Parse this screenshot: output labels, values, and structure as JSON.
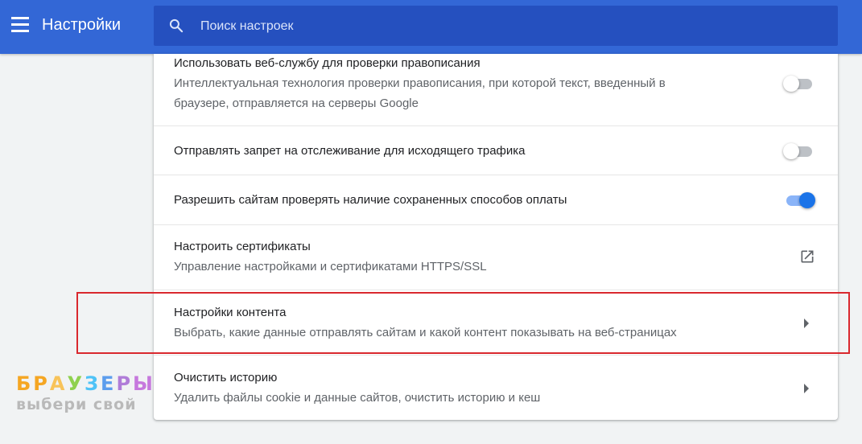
{
  "header": {
    "title": "Настройки",
    "menu_icon": "menu-icon",
    "search": {
      "placeholder": "Поиск настроек",
      "value": "",
      "icon": "search-icon"
    },
    "background_color": "#3367d6"
  },
  "settings": [
    {
      "title": "Использовать веб-службу для проверки правописания",
      "description_line1": "Интеллектуальная технология проверки правописания, при которой текст, введенный в",
      "description_line2": "браузере, отправляется на серверы Google",
      "control": "toggle",
      "enabled": false
    },
    {
      "title": "Отправлять запрет на отслеживание для исходящего трафика",
      "control": "toggle",
      "enabled": false
    },
    {
      "title": "Разрешить сайтам проверять наличие сохраненных способов оплаты",
      "control": "toggle",
      "enabled": true
    },
    {
      "title": "Настроить сертификаты",
      "description": "Управление настройками и сертификатами HTTPS/SSL",
      "control": "external-link-icon"
    },
    {
      "title": "Настройки контента",
      "description": "Выбрать, какие данные отправлять сайтам и какой контент показывать на веб-страницах",
      "control": "chevron-right-icon",
      "highlighted": true
    },
    {
      "title": "Очистить историю",
      "description": "Удалить файлы cookie и данные сайтов, очистить историю и кеш",
      "control": "chevron-right-icon"
    }
  ],
  "watermark": {
    "letters": [
      "Б",
      "Р",
      "А",
      "У",
      "З",
      "Е",
      "Р",
      "Ы"
    ],
    "letter_colors": [
      "#f5a623",
      "#f5a623",
      "#f8c35a",
      "#8fd14f",
      "#4fc3f7",
      "#5c9ded",
      "#b07cd8",
      "#c678dd"
    ],
    "slogan": "выбери свой"
  },
  "colors": {
    "accent": "#1a73e8",
    "highlight_border": "#d9282e",
    "page_background": "#f1f3f4"
  }
}
